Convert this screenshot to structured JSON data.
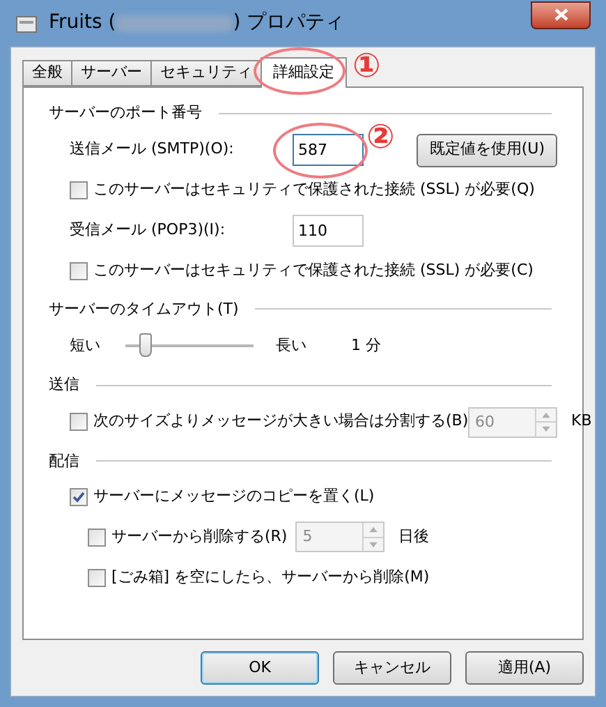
{
  "window": {
    "title_start": "Fruits (",
    "title_end": ") プロパティ"
  },
  "tabs": [
    {
      "label": "全般",
      "selected": false
    },
    {
      "label": "サーバー",
      "selected": false
    },
    {
      "label": "セキュリティ",
      "selected": false
    },
    {
      "label": "詳細設定",
      "selected": true
    }
  ],
  "sections": [
    {
      "title": "サーバーのポート番号",
      "rows": [
        {
          "kind": "field",
          "label": "送信メール (SMTP)(O):",
          "value": "587",
          "focused": true,
          "button": "既定値を使用(U)",
          "callout": "②"
        },
        {
          "kind": "checkbox",
          "label": "このサーバーはセキュリティで保護された接続 (SSL) が必要(Q)",
          "checked": false
        },
        {
          "kind": "field",
          "label": "受信メール (POP3)(I):",
          "value": "110",
          "focused": false
        },
        {
          "kind": "checkbox",
          "label": "このサーバーはセキュリティで保護された接続 (SSL) が必要(C)",
          "checked": false
        }
      ]
    },
    {
      "title": "サーバーのタイムアウト(T)",
      "rows": [
        {
          "kind": "slider",
          "min_label": "短い",
          "max_label": "長い",
          "reading": "1 分",
          "level": 0.15
        }
      ]
    },
    {
      "title": "送信",
      "rows": [
        {
          "kind": "spin_checkbox",
          "label": "次のサイズよりメッセージが大きい場合は分割する(B)",
          "checked": false,
          "value": "60",
          "disabled": true,
          "unit": "KB"
        }
      ]
    },
    {
      "title": "配信",
      "rows": [
        {
          "kind": "checkbox",
          "label": "サーバーにメッセージのコピーを置く(L)",
          "checked": true
        },
        {
          "kind": "spin_checkbox_sub",
          "label": "サーバーから削除する(R)",
          "checked": false,
          "value": "5",
          "disabled": true,
          "unit": "日後"
        },
        {
          "kind": "checkbox_sub",
          "label": "[ごみ箱] を空にしたら、サーバーから削除(M)",
          "checked": false
        }
      ]
    }
  ],
  "tab_callout": "①",
  "buttons": [
    {
      "label": "OK",
      "default": true
    },
    {
      "label": "キャンセル",
      "default": false
    },
    {
      "label": "適用(A)",
      "default": false
    }
  ]
}
